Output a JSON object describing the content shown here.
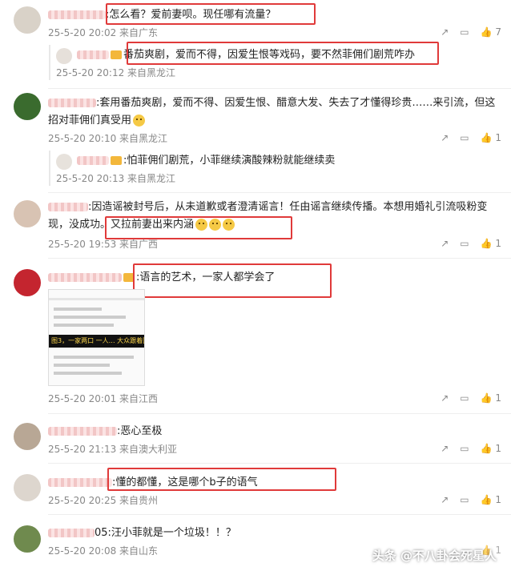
{
  "comments": [
    {
      "text": ":怎么看？爱前妻呗。现任哪有流量？",
      "meta": "25-5-20 20:02 来自广东",
      "likes": "7"
    },
    {
      "text": "番茄爽剧，爱而不得，因爱生恨等戏码，要不然菲佣们剧荒咋办",
      "meta": "25-5-20 20:12 来自黑龙江"
    },
    {
      "text": ":套用番茄爽剧，爱而不得、因爱生恨、醋意大发、失去了才懂得珍贵……来引流，但这招对菲佣们真受用",
      "meta": "25-5-20 20:10 来自黑龙江",
      "likes": "1"
    },
    {
      "text": ":怕菲佣们剧荒，小菲继续演酸辣粉就能继续卖",
      "meta": "25-5-20 20:13 来自黑龙江"
    },
    {
      "text": ":因造谣被封号后，从未道歉或者澄清谣言！任由谣言继续传播。本想用婚礼引流吸粉变现，没成功。又拉前妻出来内涵",
      "meta": "25-5-20 19:53 来自广西",
      "likes": "1"
    },
    {
      "text": ":语言的艺术，一家人都学会了",
      "meta": "25-5-20 20:01 来自江西",
      "likes": "1",
      "image_caption": "图3，一家两口 一人… 大众跟着回国"
    },
    {
      "text": ":恶心至极",
      "meta": "25-5-20 21:13 来自澳大利亚",
      "likes": "1"
    },
    {
      "text": ":懂的都懂，这是哪个b子的语气",
      "meta": "25-5-20 20:25 来自贵州",
      "likes": "1"
    },
    {
      "text": "05:汪小菲就是一个垃圾！！？",
      "meta": "25-5-20 20:08 来自山东",
      "likes": "1"
    }
  ],
  "watermark": "头条 @不八卦会死星人",
  "colors": {
    "highlight": "#e03a3a",
    "meta": "#888888"
  }
}
